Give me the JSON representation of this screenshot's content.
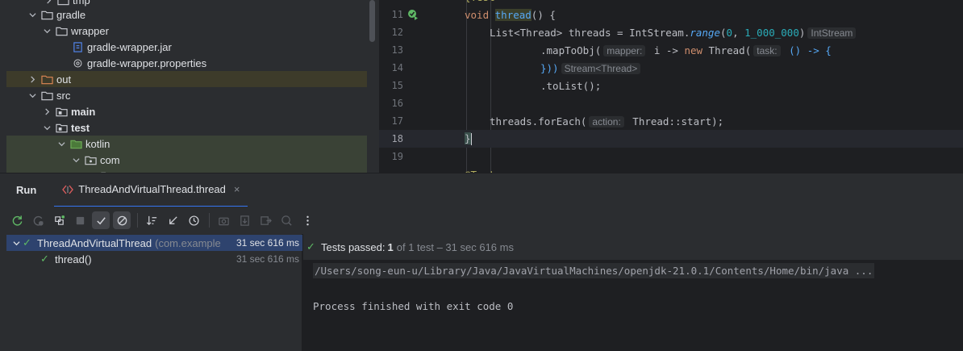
{
  "project_tree": {
    "items": [
      {
        "name": "tmp",
        "expanded": false
      },
      {
        "name": "gradle",
        "expanded": true
      },
      {
        "name": "wrapper",
        "expanded": true
      },
      {
        "name": "gradle-wrapper.jar"
      },
      {
        "name": "gradle-wrapper.properties"
      },
      {
        "name": "out",
        "expanded": false
      },
      {
        "name": "src",
        "expanded": true
      },
      {
        "name": "main",
        "expanded": false
      },
      {
        "name": "test",
        "expanded": true
      },
      {
        "name": "kotlin",
        "expanded": true
      },
      {
        "name": "com",
        "expanded": true
      }
    ]
  },
  "editor": {
    "line_numbers": [
      "11",
      "12",
      "13",
      "14",
      "15",
      "16",
      "17",
      "18",
      "19"
    ],
    "code": {
      "l11_void": "void ",
      "l11_fn": "thread",
      "l11_rest": "() {",
      "l12_a": "List<Thread> threads = IntStream.",
      "l12_range": "range",
      "l12_b": "(",
      "l12_n0": "0",
      "l12_c": ", ",
      "l12_n1": "1_000_000",
      "l12_d": ")",
      "l12_hint": "IntStream",
      "l13_a": ".mapToObj(",
      "l13_hint_mapper": "mapper:",
      "l13_b": " i -> ",
      "l13_new": "new",
      "l13_c": " Thread(",
      "l13_hint_task": "task:",
      "l13_d": " () -> {",
      "l14_a": "}))",
      "l14_hint": "Stream<Thread>",
      "l15_a": ".toList();",
      "l17_a": "threads.forEach(",
      "l17_hint": "action:",
      "l17_b": " Thread::start);",
      "l18_a": "}"
    }
  },
  "run_window": {
    "title": "Run",
    "tab_label": "ThreadAndVirtualThread.thread",
    "tab_close": "×"
  },
  "toolbar": {
    "buttons": [
      "rerun-icon",
      "rerun-failed-icon",
      "toggle-auto-test-icon",
      "stop-icon",
      "show-passed-icon",
      "show-ignored-icon",
      "sort-icon",
      "collapse-icon",
      "history-icon",
      "screenshot-icon",
      "import-icon",
      "export-icon",
      "coverage-icon",
      "more-icon"
    ]
  },
  "test_tree": {
    "root": {
      "name": "ThreadAndVirtualThread",
      "package": "(com.example",
      "time": "31 sec 616 ms"
    },
    "child": {
      "name": "thread()",
      "time": "31 sec 616 ms"
    }
  },
  "console": {
    "status_label": "Tests passed:",
    "status_count": "1",
    "status_detail": "of 1 test – 31 sec 616 ms",
    "command_line": "/Users/song-eun-u/Library/Java/JavaVirtualMachines/openjdk-21.0.1/Contents/Home/bin/java ...",
    "exit_line": "Process finished with exit code 0"
  },
  "colors": {
    "accent": "#3574f0",
    "success": "#5fb865",
    "background": "#1e1f22",
    "panel": "#2b2d30"
  }
}
